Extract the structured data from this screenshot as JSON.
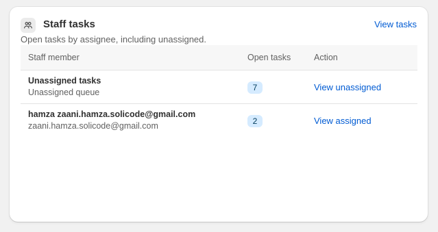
{
  "card": {
    "title": "Staff tasks",
    "subtitle": "Open tasks by assignee, including unassigned.",
    "view_tasks_label": "View tasks",
    "icon": "people-icon"
  },
  "table": {
    "headers": {
      "member": "Staff member",
      "open": "Open tasks",
      "action": "Action"
    },
    "rows": [
      {
        "name": "Unassigned tasks",
        "detail": "Unassigned queue",
        "open_tasks": "7",
        "action_label": "View unassigned"
      },
      {
        "name": "hamza zaani.hamza.solicode@gmail.com",
        "detail": "zaani.hamza.solicode@gmail.com",
        "open_tasks": "2",
        "action_label": "View assigned"
      }
    ]
  },
  "colors": {
    "link": "#005bd3",
    "badge_bg": "#d5ebff",
    "header_bg": "#f7f7f7"
  }
}
